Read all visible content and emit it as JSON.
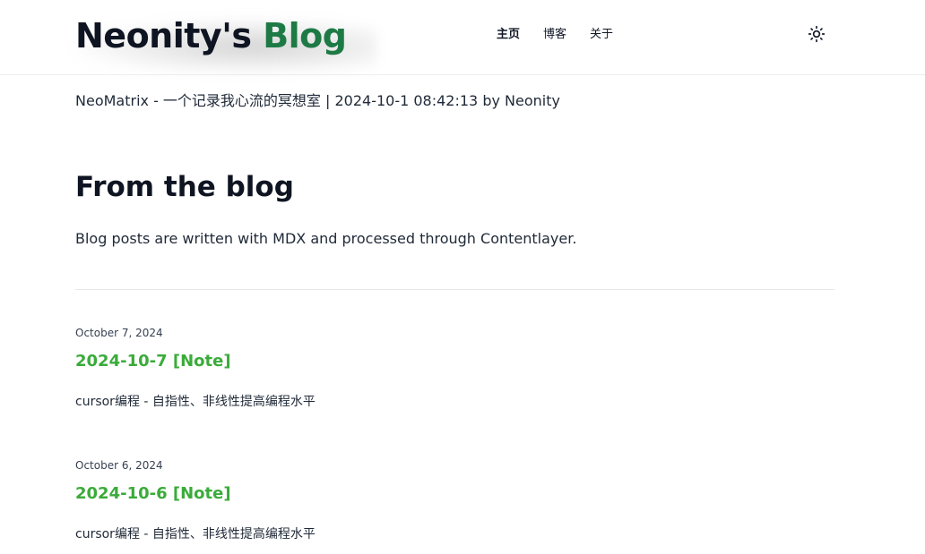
{
  "header": {
    "logo_main": "Neonity's ",
    "logo_accent": "Blog",
    "nav": [
      {
        "label": "主页"
      },
      {
        "label": "博客"
      },
      {
        "label": "关于"
      }
    ],
    "theme_toggle_icon": "sun-icon"
  },
  "subline": "NeoMatrix - 一个记录我心流的冥想室 | 2024-10-1 08:42:13 by Neonity",
  "section": {
    "title": "From the blog",
    "description": "Blog posts are written with MDX and processed through Contentlayer."
  },
  "posts": [
    {
      "date": "October 7, 2024",
      "title": "2024-10-7 [Note]",
      "description": "cursor编程 - 自指性、非线性提高编程水平"
    },
    {
      "date": "October 6, 2024",
      "title": "2024-10-6 [Note]",
      "description": "cursor编程 - 自指性、非线性提高编程水平"
    }
  ],
  "colors": {
    "accent": "#1e7a45",
    "post_title": "#3aab3a",
    "text": "#111827"
  }
}
